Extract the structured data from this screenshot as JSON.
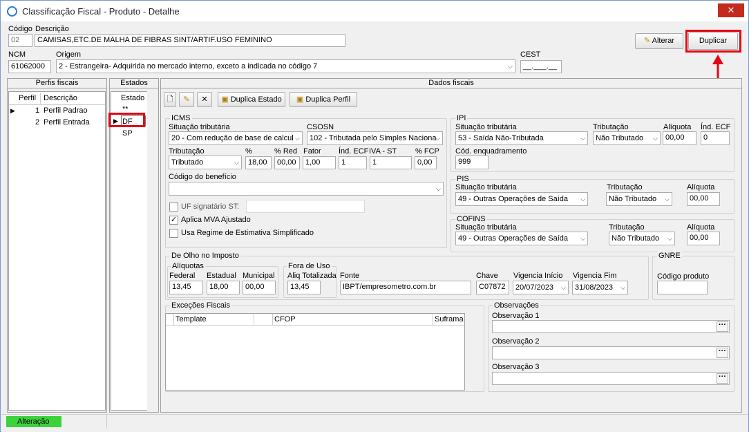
{
  "window": {
    "title": "Classificação Fiscal - Produto - Detalhe",
    "close": "✕"
  },
  "header": {
    "codigo_label": "Código",
    "codigo": "02",
    "descricao_label": "Descrição",
    "descricao": "CAMISAS,ETC.DE MALHA DE FIBRAS SINT/ARTIF.USO FEMININO",
    "ncm_label": "NCM",
    "ncm": "61062000",
    "origem_label": "Origem",
    "origem": "2 - Estrangeira- Adquirida no mercado interno, exceto a indicada no código 7",
    "cest_label": "CEST",
    "cest": "__.___.__",
    "alterar": "Alterar",
    "duplicar": "Duplicar"
  },
  "perfis": {
    "title": "Perfis fiscais",
    "col_perfil": "Perfil",
    "col_descricao": "Descrição",
    "rows": [
      {
        "id": "1",
        "desc": "Perfil Padrao"
      },
      {
        "id": "2",
        "desc": "Perfil Entrada"
      }
    ]
  },
  "estados": {
    "title": "Estados",
    "col": "Estado",
    "rows": [
      "**",
      "DF",
      "SP"
    ]
  },
  "dados": {
    "title": "Dados fiscais",
    "duplica_estado": "Duplica Estado",
    "duplica_perfil": "Duplica Perfil",
    "icms": {
      "title": "ICMS",
      "sit_label": "Situação tributária",
      "sit": "20 - Com redução de base de calcul",
      "csosn_label": "CSOSN",
      "csosn": "102 - Tributada pelo Simples Naciona",
      "trib_label": "Tributação",
      "trib": "Tributado",
      "pct_label": "%",
      "pct": "18,00",
      "red_label": "% Red",
      "red": "00,00",
      "fator_label": "Fator",
      "fator": "1,00",
      "ecf_label": "Índ. ECF",
      "ecf": "1",
      "iva_label": "IVA - ST",
      "iva": "1",
      "fcp_label": "% FCP",
      "fcp": "0,00",
      "beneficio_label": "Código do benefício",
      "beneficio": "",
      "uf_label": "UF signatário ST:",
      "mva_label": "Aplica MVA Ajustado",
      "regime_label": "Usa Regime de Estimativa Simplificado"
    },
    "ipi": {
      "title": "IPI",
      "sit_label": "Situação tributária",
      "sit": "53 - Saída Não-Tributada",
      "trib_label": "Tributação",
      "trib": "Não Tributado",
      "aliq_label": "Alíquota",
      "aliq": "00,00",
      "ecf_label": "Índ. ECF",
      "ecf": "0",
      "enq_label": "Cód. enquadramento",
      "enq": "999"
    },
    "pis": {
      "title": "PIS",
      "sit_label": "Situação tributária",
      "sit": "49 - Outras Operações de Saída",
      "trib_label": "Tributação",
      "trib": "Não Tributado",
      "aliq_label": "Alíquota",
      "aliq": "00,00"
    },
    "cofins": {
      "title": "COFINS",
      "sit_label": "Situação tributária",
      "sit": "49 - Outras Operações de Saída",
      "trib_label": "Tributação",
      "trib": "Não Tributado",
      "aliq_label": "Alíquota",
      "aliq": "00,00"
    },
    "olho": {
      "title": "De Olho no Imposto",
      "aliquotas": "Alíquotas",
      "federal_label": "Federal",
      "federal": "13,45",
      "estadual_label": "Estadual",
      "estadual": "18,00",
      "municipal_label": "Municipal",
      "municipal": "00,00",
      "fora_label": "Fora de Uso",
      "aliqtot_label": "Aliq Totalizada",
      "aliqtot": "13,45",
      "fonte_label": "Fonte",
      "fonte": "IBPT/empresometro.com.br",
      "chave_label": "Chave",
      "chave": "C07872",
      "vini_label": "Vigencia Início",
      "vini": "20/07/2023",
      "vfim_label": "Vigencia Fim",
      "vfim": "31/08/2023"
    },
    "gnre": {
      "title": "GNRE",
      "cod_label": "Código produto",
      "cod": ""
    },
    "excecoes": {
      "title": "Exceções Fiscais",
      "cols": [
        "Template",
        "CFOP",
        "Suframa"
      ]
    },
    "obs": {
      "title": "Observações",
      "o1": "Observação 1",
      "o2": "Observação 2",
      "o3": "Observação 3",
      "btn": "···"
    }
  },
  "status": {
    "text": "Alteração"
  }
}
